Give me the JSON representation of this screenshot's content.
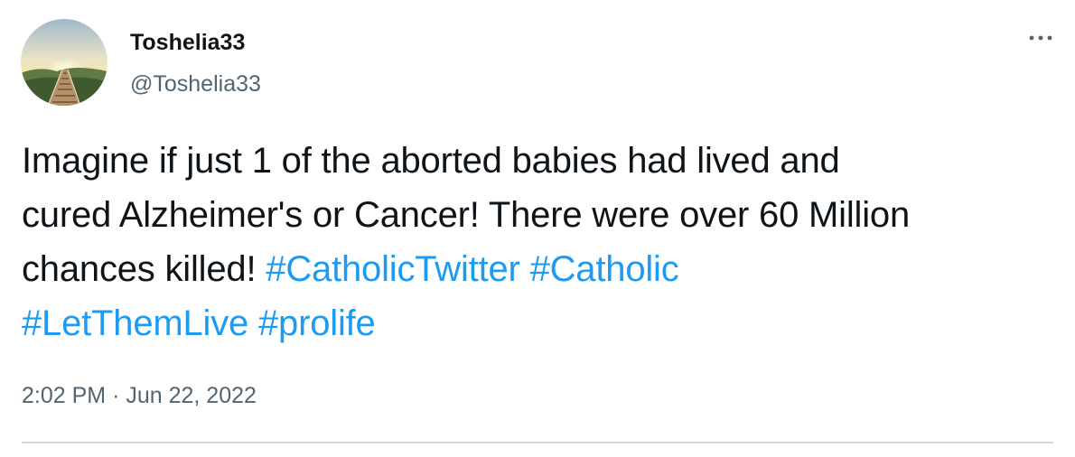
{
  "user": {
    "display_name": "Toshelia33",
    "handle": "@Toshelia33",
    "avatar_icon": "boardwalk-sunrise-avatar"
  },
  "header": {
    "more_icon": "more-horizontal-icon"
  },
  "tweet": {
    "text_lines": {
      "line1": "Imagine if just 1 of the aborted babies had lived and",
      "line2": "cured Alzheimer's or Cancer! There were over 60 Million",
      "line3_text": "chances killed!"
    },
    "hashtags": [
      "#CatholicTwitter",
      "#Catholic",
      "#LetThemLive",
      "#prolife"
    ],
    "time": "2:02 PM",
    "separator": "·",
    "date": "Jun 22, 2022"
  },
  "colors": {
    "link": "#1d9bf0",
    "secondary_text": "#536471",
    "primary_text": "#0f1419",
    "divider": "#cfd9de"
  }
}
